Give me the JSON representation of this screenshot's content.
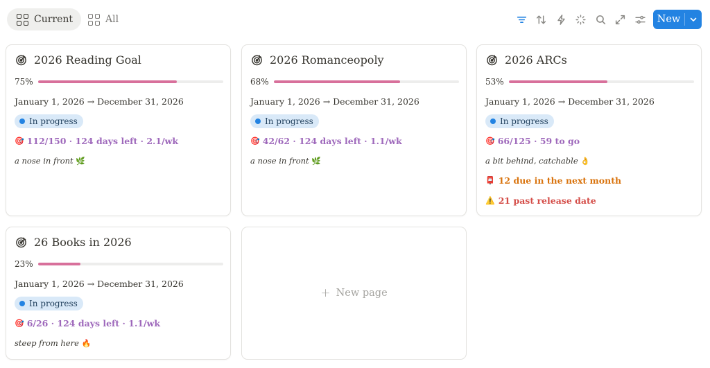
{
  "toolbar": {
    "views": [
      {
        "label": "Current",
        "active": true
      },
      {
        "label": "All",
        "active": false
      }
    ],
    "icons": [
      "filter-icon",
      "sort-icon",
      "automation-icon",
      "ai-sparkle-icon",
      "search-icon",
      "expand-icon",
      "settings-icon"
    ],
    "new_label": "New",
    "accent_color": "#2383e2"
  },
  "cards": [
    {
      "title": "2026 Reading Goal",
      "progress_label": "75%",
      "progress": 0.75,
      "dates": "January 1, 2026 → December 31, 2026",
      "status": "In progress",
      "stats": "112/150 · 124 days left · 2.1/wk",
      "note": "a nose in front",
      "note_emoji": "🌿"
    },
    {
      "title": "2026 Romanceopoly",
      "progress_label": "68%",
      "progress": 0.68,
      "dates": "January 1, 2026 → December 31, 2026",
      "status": "In progress",
      "stats": "42/62 · 124 days left · 1.1/wk",
      "note": "a nose in front",
      "note_emoji": "🌿"
    },
    {
      "title": "2026 ARCs",
      "progress_label": "53%",
      "progress": 0.53,
      "dates": "January 1, 2026 → December 31, 2026",
      "status": "In progress",
      "stats": "66/125 · 59 to go",
      "note": "a bit behind, catchable",
      "note_emoji": "👌",
      "alerts": [
        {
          "emoji": "📮",
          "text": "12 due in the next month"
        },
        {
          "emoji": "⚠️",
          "text": "21 past release date"
        }
      ]
    },
    {
      "title": "26 Books in 2026",
      "progress_label": "23%",
      "progress": 0.23,
      "dates": "January 1, 2026 → December 31, 2026",
      "status": "In progress",
      "stats": "6/26 · 124 days left · 1.1/wk",
      "note": "steep from here",
      "note_emoji": "🔥"
    }
  ],
  "new_page": {
    "label": "New page"
  },
  "colors": {
    "progress_fill": "#d8709b",
    "status_bg": "#d9e9f8",
    "status_dot": "#2383e2",
    "stats_text": "#9e68bb",
    "alert_orange": "#d9730d",
    "alert_red": "#d44c47"
  }
}
